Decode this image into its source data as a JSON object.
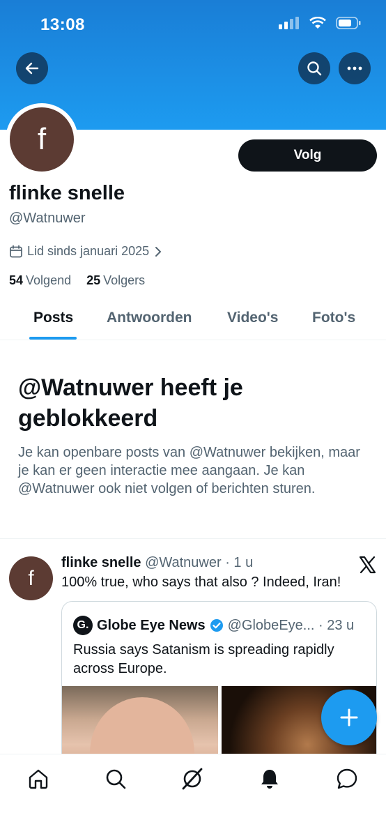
{
  "status_bar": {
    "time": "13:08"
  },
  "header": {
    "back_icon": "arrow-left-icon",
    "search_icon": "search-icon",
    "more_icon": "more-dots-icon"
  },
  "profile": {
    "avatar_letter": "f",
    "avatar_color": "#5c3b33",
    "follow_label": "Volg",
    "display_name": "flinke snelle",
    "handle": "@Watnuwer",
    "joined": "Lid sinds januari 2025",
    "following_count": "54",
    "following_label": "Volgend",
    "followers_count": "25",
    "followers_label": "Volgers"
  },
  "tabs": [
    {
      "label": "Posts",
      "active": true
    },
    {
      "label": "Antwoorden",
      "active": false
    },
    {
      "label": "Video's",
      "active": false
    },
    {
      "label": "Foto's",
      "active": false
    }
  ],
  "blocked": {
    "title": "@Watnuwer heeft je geblokkeerd",
    "text": "Je kan openbare posts van @Watnuwer bekijken, maar je kan er geen interactie mee aangaan. Je kan @Watnuwer ook niet volgen of berichten sturen."
  },
  "post": {
    "avatar_letter": "f",
    "name": "flinke snelle",
    "handle_time": "@Watnuwer · 1 u",
    "text": "100% true, who says that also ? Indeed, Iran!",
    "quote": {
      "logo_letter": "G.",
      "name": "Globe Eye News",
      "handle_time": "@GlobeEye... · 23 u",
      "text": "Russia says Satanism is spreading rapidly across Europe."
    }
  },
  "colors": {
    "accent": "#1d9bf0",
    "text": "#0f1419",
    "secondary": "#536471"
  },
  "bottom_nav": [
    "home-icon",
    "search-icon",
    "grok-icon",
    "notifications-icon",
    "messages-icon"
  ]
}
